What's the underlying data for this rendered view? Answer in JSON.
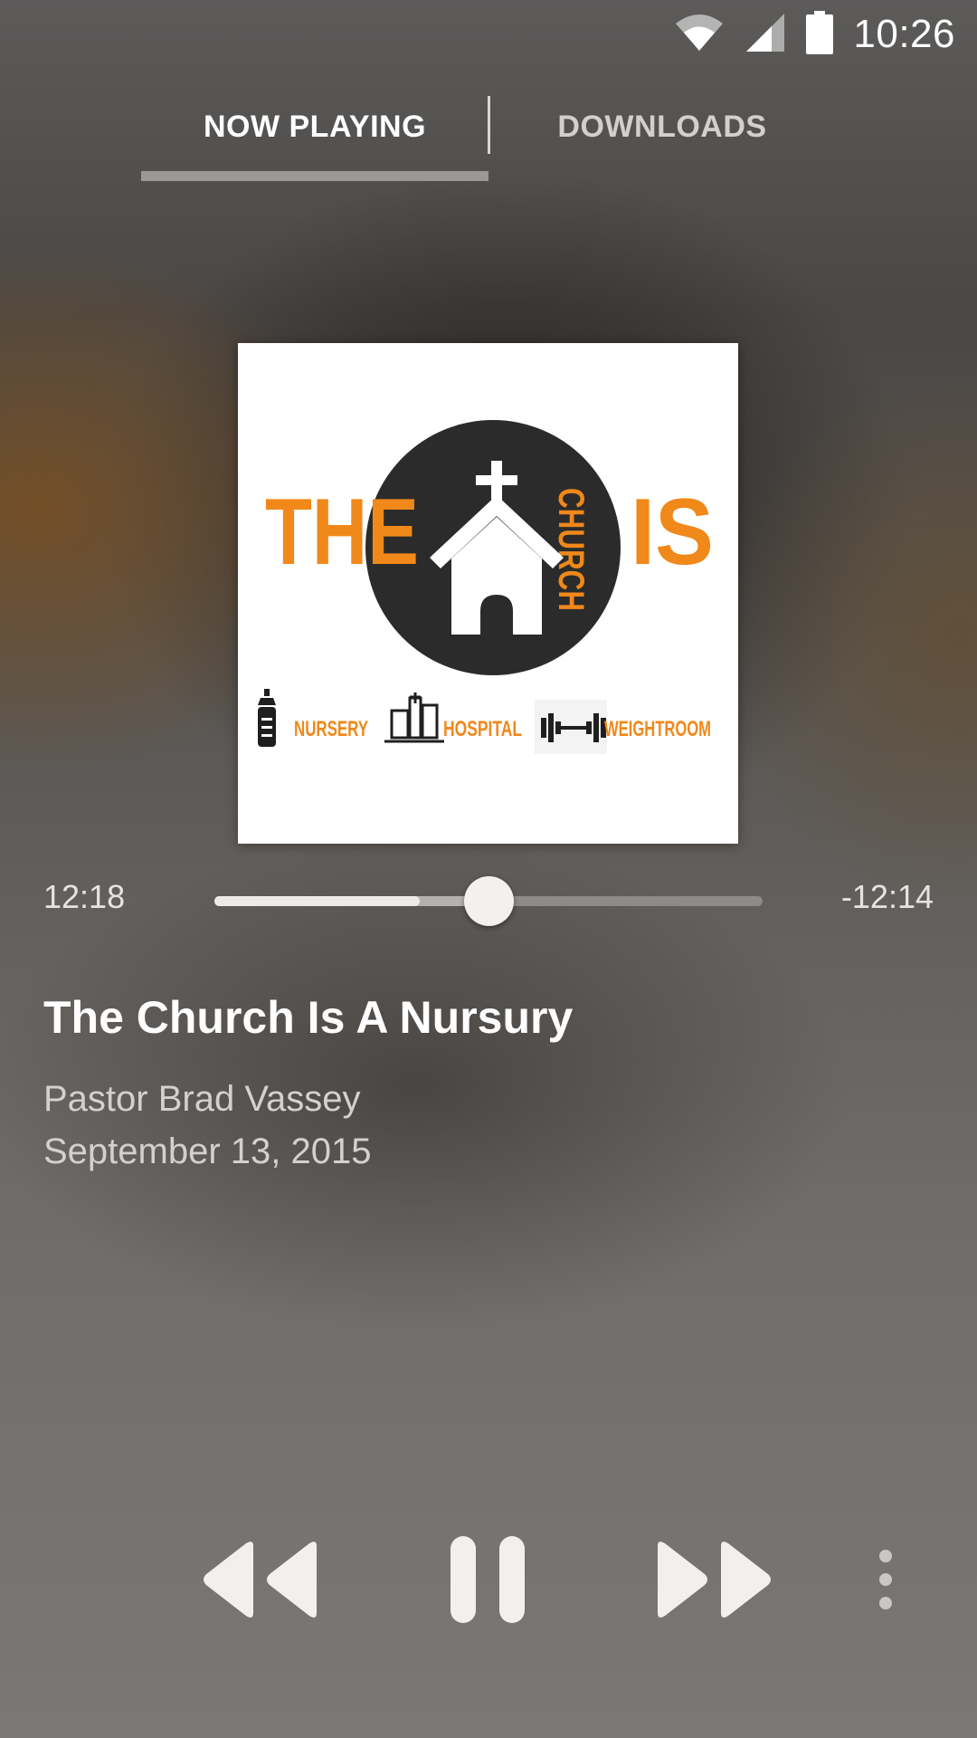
{
  "status_bar": {
    "time": "10:26",
    "icons": [
      "wifi-icon",
      "cell-signal-icon",
      "battery-icon"
    ]
  },
  "tabs": [
    {
      "label": "NOW PLAYING",
      "selected": true
    },
    {
      "label": "DOWNLOADS",
      "selected": false
    }
  ],
  "artwork": {
    "logo_text": {
      "left": "THE",
      "center": "CHURCH",
      "right": "IS"
    },
    "sub_items": [
      {
        "icon": "baby-bottle-icon",
        "label": "NURSERY"
      },
      {
        "icon": "hospital-icon",
        "label": "HOSPITAL"
      },
      {
        "icon": "dumbbell-icon",
        "label": "WEIGHTROOM"
      }
    ],
    "colors": {
      "orange": "#F0881A",
      "dark": "#2b2b2b"
    }
  },
  "player": {
    "elapsed": "12:18",
    "remaining": "-12:14",
    "progress_fraction": 0.5,
    "buffered_fraction": 0.375
  },
  "episode": {
    "title": "The Church Is A Nursury",
    "speaker": "Pastor Brad Vassey",
    "date": "September 13, 2015"
  },
  "controls": [
    "rewind-icon",
    "pause-icon",
    "fast-forward-icon",
    "more-vert-icon"
  ]
}
